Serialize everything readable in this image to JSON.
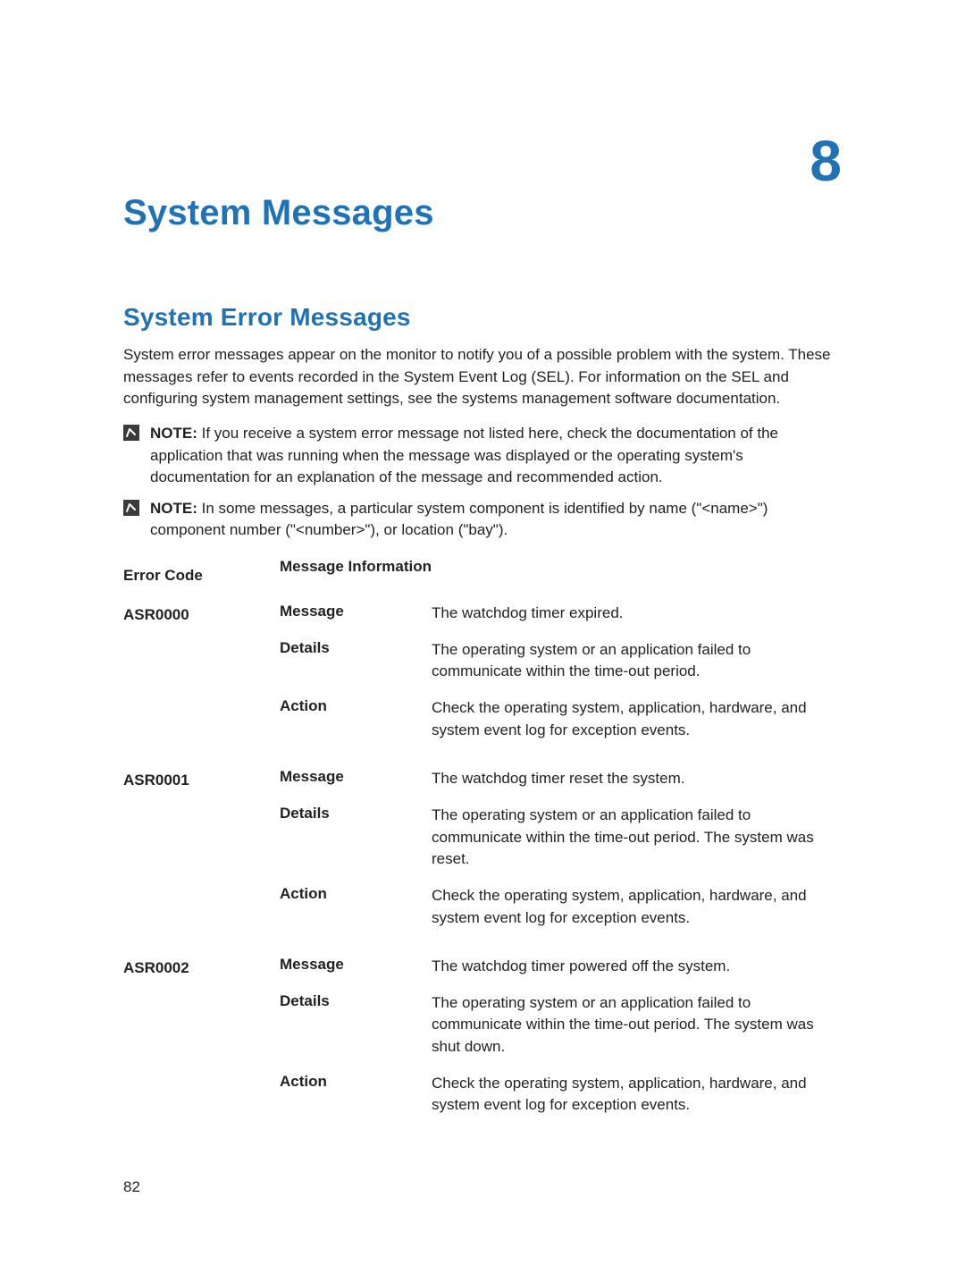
{
  "chapter_number": "8",
  "title": "System Messages",
  "section_heading": "System Error Messages",
  "intro": "System error messages appear on the monitor to notify you of a possible problem with the system. These messages refer to events recorded in the System Event Log (SEL). For information on the SEL and configuring system management settings, see the systems management software documentation.",
  "notes": [
    {
      "label": "NOTE:",
      "text": " If you receive a system error message not listed here, check the documentation of the application that was running when the message was displayed or the operating system's documentation for an explanation of the message and recommended action."
    },
    {
      "label": "NOTE:",
      "text": " In some messages, a particular system component is identified by name (\"<name>\") component number (\"<number>\"), or location (\"bay\")."
    }
  ],
  "table": {
    "header_code": "Error Code",
    "header_info": "Message Information",
    "key_message": "Message",
    "key_details": "Details",
    "key_action": "Action",
    "rows": [
      {
        "code": "ASR0000",
        "message": "The watchdog timer expired.",
        "details": "The operating system or an application failed to communicate within the time-out period.",
        "action": "Check the operating system, application, hardware, and system event log for exception events."
      },
      {
        "code": "ASR0001",
        "message": "The watchdog timer reset the system.",
        "details": "The operating system or an application failed to communicate within the time-out period. The system was reset.",
        "action": "Check the operating system, application, hardware, and system event log for exception events."
      },
      {
        "code": "ASR0002",
        "message": "The watchdog timer powered off the system.",
        "details": "The operating system or an application failed to communicate within the time-out period. The system was shut down.",
        "action": "Check the operating system, application, hardware, and system event log for exception events."
      }
    ]
  },
  "page_number": "82"
}
